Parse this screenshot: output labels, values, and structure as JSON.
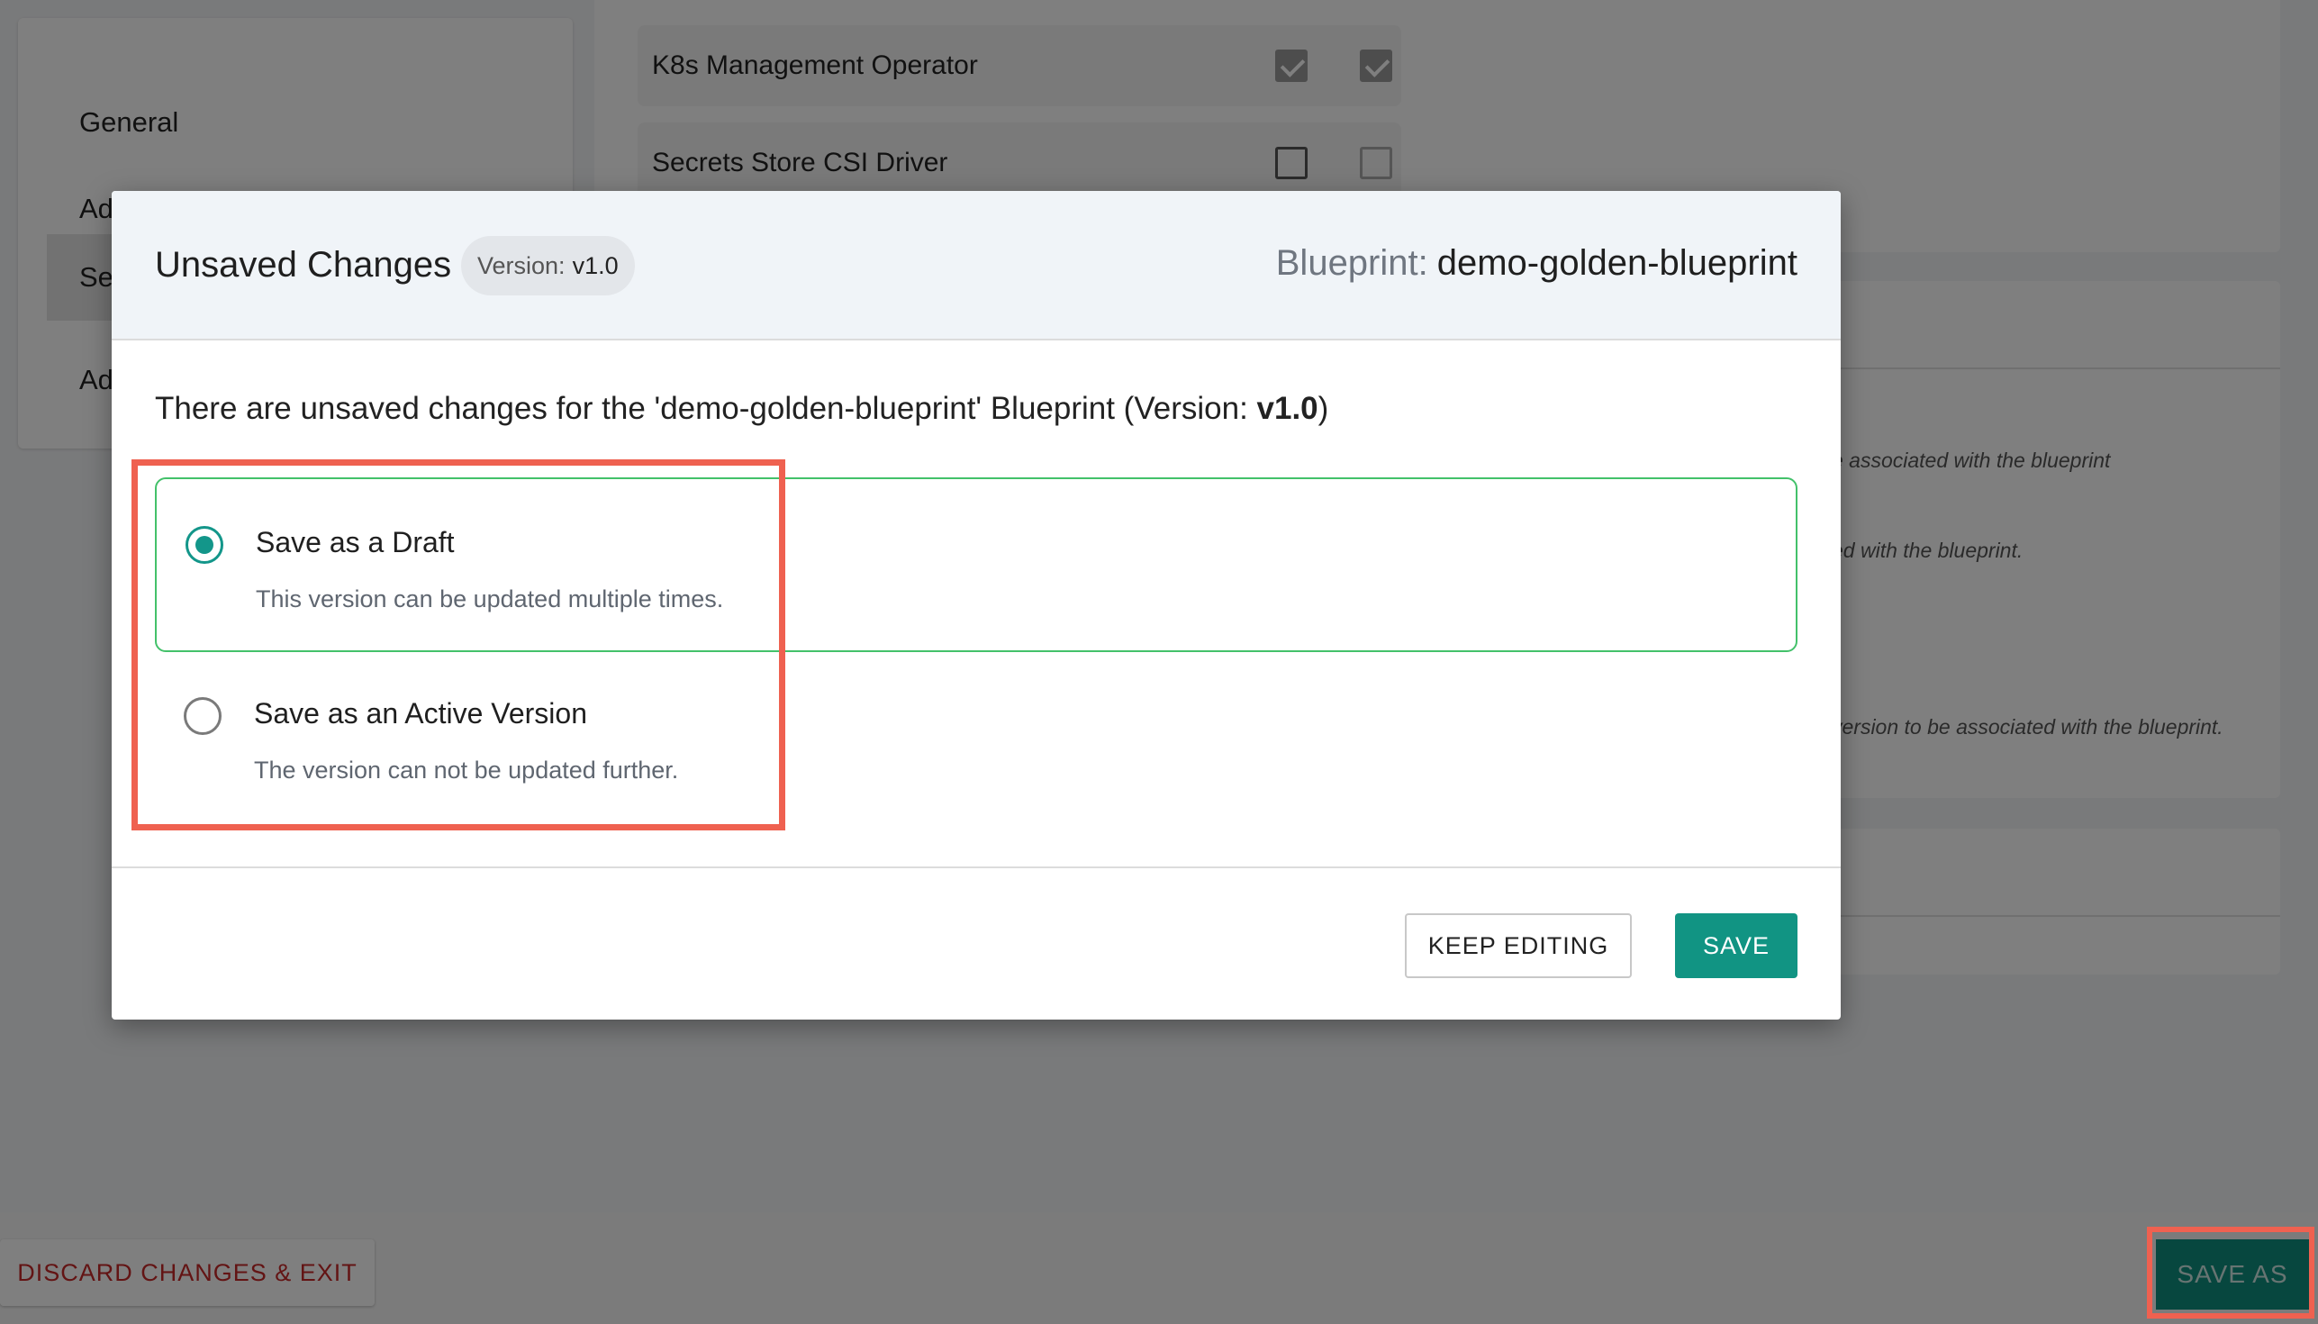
{
  "background": {
    "nav": {
      "items": [
        {
          "label": "General"
        },
        {
          "label": "Add-Ons"
        },
        {
          "label": "Services"
        },
        {
          "label": "Advanced"
        }
      ]
    },
    "addons": [
      {
        "name": "K8s Management Operator",
        "col1_checked": true,
        "col2_checked": true
      },
      {
        "name": "Secrets Store CSI Driver",
        "col1_checked": false,
        "col2_checked": false
      }
    ],
    "right_notes": [
      "e associated with the blueprint",
      "ed with the blueprint.",
      "version to be associated with the blueprint."
    ]
  },
  "modal": {
    "title": "Unsaved Changes",
    "version_label": "Version:",
    "version_value": "v1.0",
    "blueprint_label": "Blueprint:",
    "blueprint_name": "demo-golden-blueprint",
    "message_prefix": "There are unsaved changes for the 'demo-golden-blueprint' Blueprint (Version: ",
    "message_version": "v1.0",
    "message_suffix": ")",
    "options": [
      {
        "title": "Save as a Draft",
        "description": "This version can be updated multiple times.",
        "selected": true
      },
      {
        "title": "Save as an Active Version",
        "description": "The version can not be updated further.",
        "selected": false
      }
    ],
    "keep_editing_label": "KEEP EDITING",
    "save_label": "SAVE"
  },
  "footer": {
    "discard_label": "DISCARD CHANGES & EXIT",
    "save_as_label": "SAVE AS"
  },
  "colors": {
    "accent": "#119483",
    "selected_border": "#43c16a",
    "highlight": "#ef6150",
    "danger": "#c62828"
  }
}
